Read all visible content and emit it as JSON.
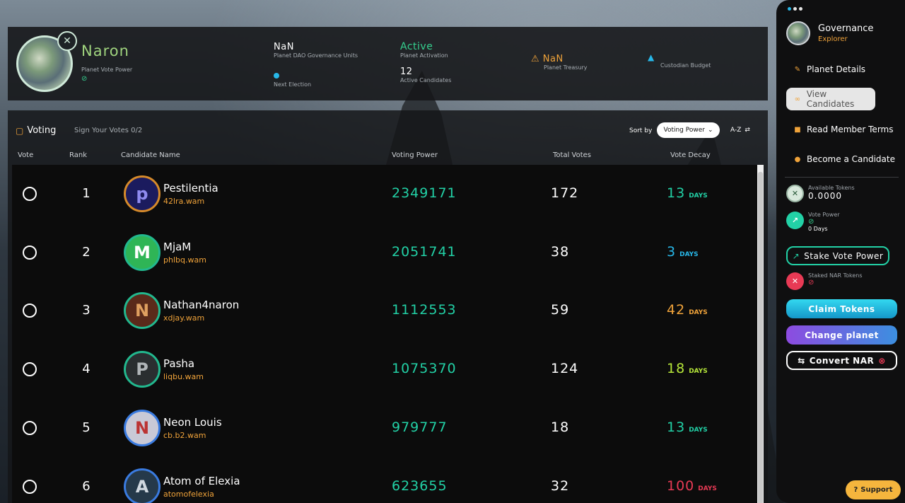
{
  "planet": {
    "name": "Naron",
    "vote_power_label": "Planet Vote Power",
    "stats": {
      "governance_units_value": "NaN",
      "governance_units_label": "Planet DAO Governance Units",
      "next_election_label": "Next Election",
      "activation_value": "Active",
      "activation_label": "Planet Activation",
      "active_candidates_value": "12",
      "active_candidates_label": "Active Candidates",
      "treasury_value": "NaN",
      "treasury_label": "Planet Treasury",
      "custodian_budget_label": "Custodian Budget"
    }
  },
  "voting": {
    "title": "Voting",
    "sign_votes": "Sign Your Votes 0/2",
    "sort_label": "Sort by",
    "sort_selected": "Voting Power",
    "order_label": "A-Z",
    "columns": {
      "vote": "Vote",
      "rank": "Rank",
      "candidate": "Candidate Name",
      "voting_power": "Voting Power",
      "total_votes": "Total Votes",
      "vote_decay": "Vote Decay"
    },
    "candidates": [
      {
        "rank": "1",
        "name": "Pestilentia",
        "account": "42lra.wam",
        "voting_power": "2349171",
        "total_votes": "172",
        "decay": "13",
        "decay_unit": "DAYS",
        "decay_color": "#22d1a6",
        "avatar_letter": "p",
        "avatar_bg": "#1b1b5e",
        "avatar_border": "#d68a2a",
        "avatar_color": "#8f8bf0"
      },
      {
        "rank": "2",
        "name": "MjaM",
        "account": "phlbq.wam",
        "voting_power": "2051741",
        "total_votes": "38",
        "decay": "3",
        "decay_unit": "DAYS",
        "decay_color": "#27b7e8",
        "avatar_letter": "M",
        "avatar_bg": "#2fb556",
        "avatar_border": "#22b88e",
        "avatar_color": "#ffffff"
      },
      {
        "rank": "3",
        "name": "Nathan4naron",
        "account": "xdjay.wam",
        "voting_power": "1112553",
        "total_votes": "59",
        "decay": "42",
        "decay_unit": "DAYS",
        "decay_color": "#f0a33a",
        "avatar_letter": "N",
        "avatar_bg": "#5a2a1a",
        "avatar_border": "#22b88e",
        "avatar_color": "#e0a060"
      },
      {
        "rank": "4",
        "name": "Pasha",
        "account": "liqbu.wam",
        "voting_power": "1075370",
        "total_votes": "124",
        "decay": "18",
        "decay_unit": "DAYS",
        "decay_color": "#b7e83a",
        "avatar_letter": "P",
        "avatar_bg": "#2a2e30",
        "avatar_border": "#22b88e",
        "avatar_color": "#b0b5b8"
      },
      {
        "rank": "5",
        "name": "Neon Louis",
        "account": "cb.b2.wam",
        "voting_power": "979777",
        "total_votes": "18",
        "decay": "13",
        "decay_unit": "DAYS",
        "decay_color": "#22d1a6",
        "avatar_letter": "N",
        "avatar_bg": "#c9c9d6",
        "avatar_border": "#3a7be0",
        "avatar_color": "#b33"
      },
      {
        "rank": "6",
        "name": "Atom of Elexia",
        "account": "atomofelexia",
        "voting_power": "623655",
        "total_votes": "32",
        "decay": "100",
        "decay_unit": "DAYS",
        "decay_color": "#e83a55",
        "avatar_letter": "A",
        "avatar_bg": "#25394a",
        "avatar_border": "#3a7be0",
        "avatar_color": "#d0d8e0"
      }
    ]
  },
  "sidebar": {
    "title": "Governance",
    "subtitle": "Explorer",
    "nav": [
      {
        "label": "Planet Details",
        "icon": "edit-icon"
      },
      {
        "label": "View Candidates",
        "icon": "users-icon"
      },
      {
        "label": "Read Member Terms",
        "icon": "document-icon"
      },
      {
        "label": "Become a Candidate",
        "icon": "user-icon"
      }
    ],
    "available_tokens_label": "Available Tokens",
    "available_tokens_value": "0.0000",
    "vote_power_label": "Vote Power",
    "vote_power_days": "0 Days",
    "stake_button": "Stake Vote Power",
    "staked_label": "Staked NAR Tokens",
    "claim_button": "Claim Tokens",
    "change_button": "Change planet",
    "convert_button": "Convert NAR"
  },
  "support": {
    "label": "Support"
  },
  "colors": {
    "accent_green": "#22d1a6",
    "accent_orange": "#f0a33a",
    "accent_red": "#e83a55"
  }
}
